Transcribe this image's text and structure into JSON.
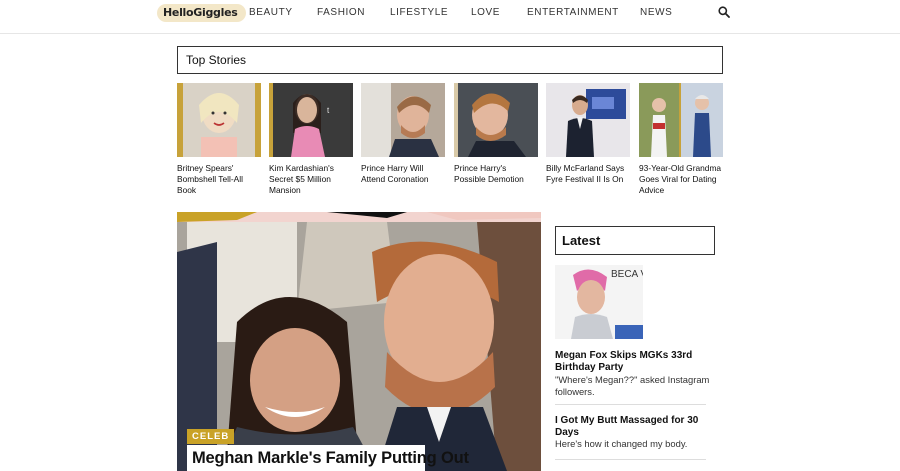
{
  "header": {
    "logo": "HelloGiggles",
    "nav": [
      "BEAUTY",
      "FASHION",
      "LIFESTYLE",
      "LOVE",
      "ENTERTAINMENT",
      "NEWS"
    ]
  },
  "top_stories": {
    "title": "Top Stories",
    "items": [
      {
        "caption": "Britney Spears' Bombshell Tell-All Book"
      },
      {
        "caption": "Kim Kardashian's Secret $5 Million Mansion"
      },
      {
        "caption": "Prince Harry Will Attend Coronation"
      },
      {
        "caption": "Prince Harry's Possible Demotion"
      },
      {
        "caption": "Billy McFarland Says Fyre Festival II Is On"
      },
      {
        "caption": "93-Year-Old Grandma Goes Viral for Dating Advice"
      }
    ]
  },
  "hero": {
    "badge": "CELEB",
    "headline": "Meghan Markle's Family Putting Out"
  },
  "latest": {
    "title": "Latest",
    "img_text": "BECA VAL",
    "items": [
      {
        "headline": "Megan Fox Skips MGKs 33rd Birthday Party",
        "sub": "\"Where's Megan??\" asked Instagram followers."
      },
      {
        "headline": "I Got My Butt Massaged for 30 Days",
        "sub": "Here's how it changed my body."
      }
    ]
  },
  "colors": {
    "accent": "#c9a227",
    "border": "#333333",
    "logo_bg": "#f3e7c8"
  }
}
